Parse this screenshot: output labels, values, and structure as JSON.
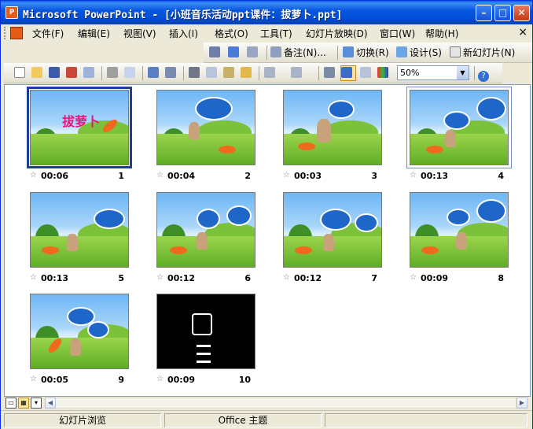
{
  "window": {
    "title": "Microsoft PowerPoint - [小班音乐活动ppt课件：拔萝卜.ppt]",
    "app_icon_glyph": "P",
    "minimize_glyph": "–",
    "maximize_glyph": "□",
    "close_glyph": "✕"
  },
  "menu": {
    "items": [
      "文件(F)",
      "编辑(E)",
      "视图(V)",
      "插入(I)",
      "格式(O)",
      "工具(T)",
      "幻灯片放映(D)",
      "窗口(W)",
      "帮助(H)"
    ],
    "close_glyph": "×"
  },
  "toolbar_top": {
    "notes_label": "备注(N)...",
    "transition_label": "切换(R)",
    "design_label": "设计(S)",
    "new_slide_label": "新幻灯片(N)"
  },
  "toolbar_std": {
    "zoom": "50%",
    "help_glyph": "?"
  },
  "slides": [
    {
      "number": "1",
      "time": "00:06",
      "title_text": "拔萝卜"
    },
    {
      "number": "2",
      "time": "00:04"
    },
    {
      "number": "3",
      "time": "00:03"
    },
    {
      "number": "4",
      "time": "00:13"
    },
    {
      "number": "5",
      "time": "00:13"
    },
    {
      "number": "6",
      "time": "00:12"
    },
    {
      "number": "7",
      "time": "00:12"
    },
    {
      "number": "8",
      "time": "00:09"
    },
    {
      "number": "9",
      "time": "00:05"
    },
    {
      "number": "10",
      "time": "00:09"
    }
  ],
  "status": {
    "view": "幻灯片浏览",
    "theme": "Office 主题"
  },
  "colors": {
    "titlebar": "#0050D8",
    "selection": "#1E3F96",
    "title_text": "#E2187A"
  }
}
